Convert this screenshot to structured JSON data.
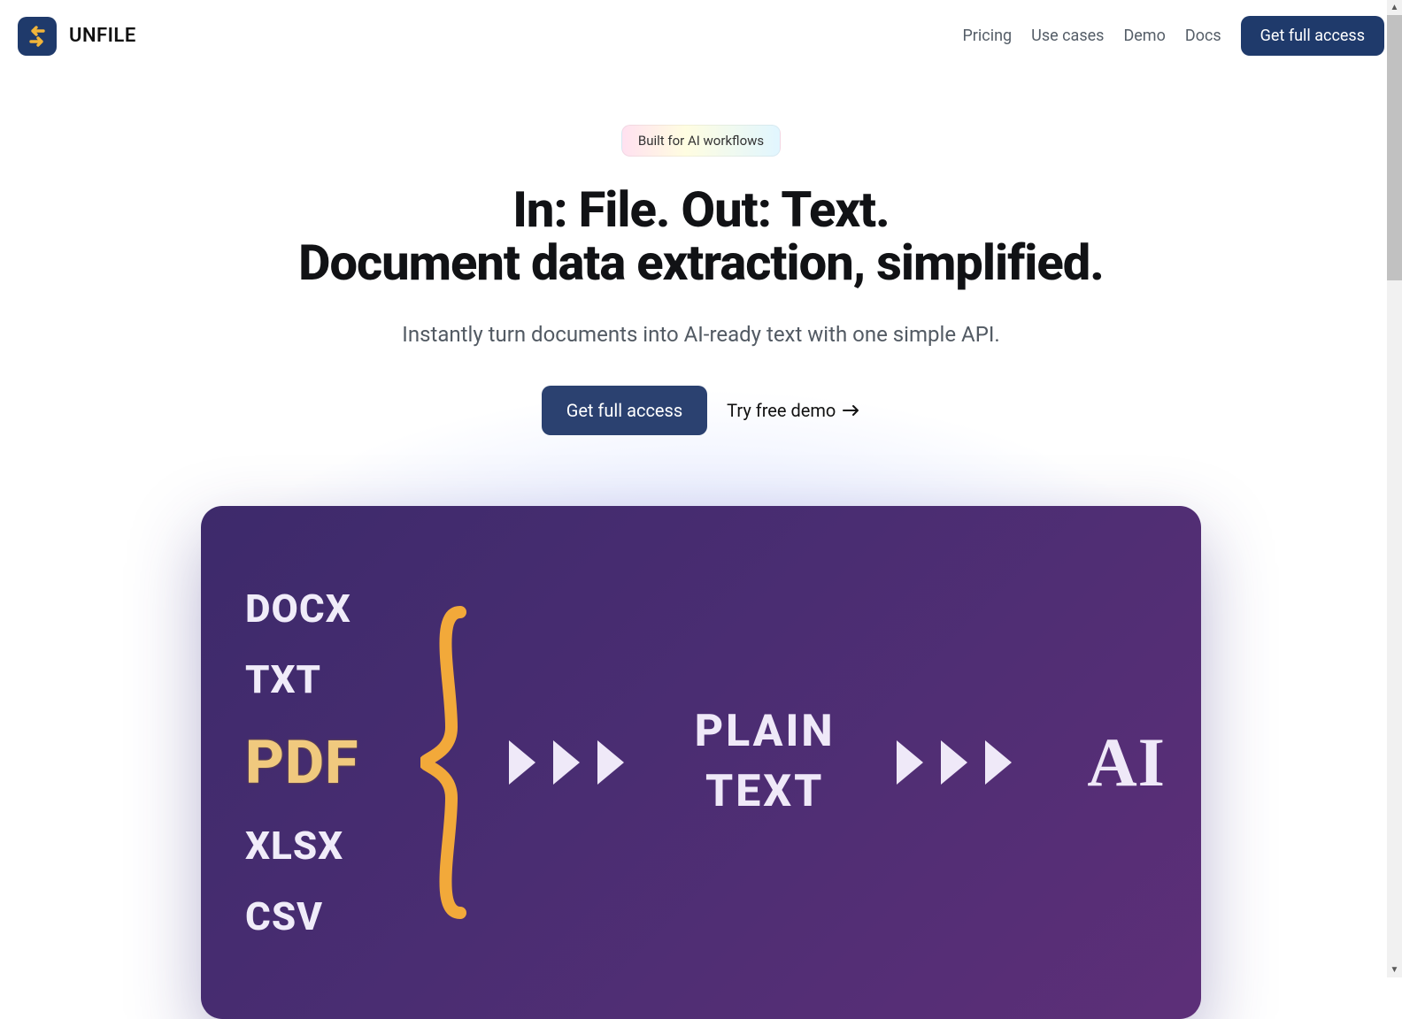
{
  "header": {
    "brand": "UNFILE",
    "nav": {
      "pricing": "Pricing",
      "usecases": "Use cases",
      "demo": "Demo",
      "docs": "Docs"
    },
    "cta": "Get full access"
  },
  "hero": {
    "badge": "Built for AI workflows",
    "h1_line1": "In: File. Out: Text.",
    "h1_line2": "Document data extraction, simplified.",
    "subhead": "Instantly turn documents into AI-ready text with one simple API.",
    "cta_primary": "Get full access",
    "cta_secondary": "Try free demo"
  },
  "diagram": {
    "formats": {
      "docx": "DOCX",
      "txt": "TXT",
      "pdf": "PDF",
      "xlsx": "XLSX",
      "csv": "CSV"
    },
    "plain": "PLAIN",
    "text": "TEXT",
    "ai": "AI"
  }
}
